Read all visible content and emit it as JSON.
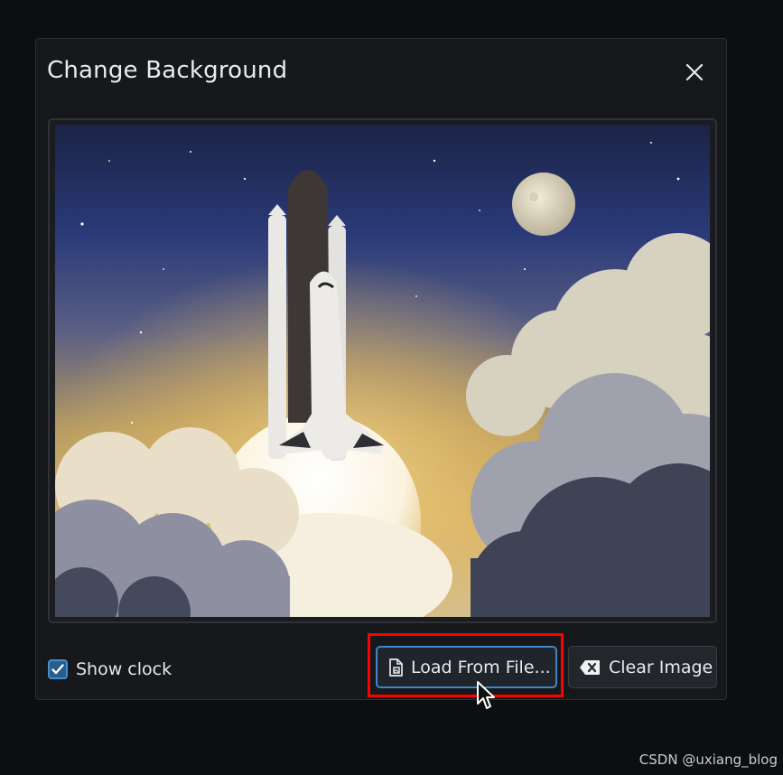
{
  "dialog": {
    "title": "Change Background",
    "close_icon": "close-icon",
    "preview_image": "space-shuttle-launch-illustration"
  },
  "controls": {
    "show_clock_label": "Show clock",
    "show_clock_checked": true,
    "load_button_label": "Load From File...",
    "load_button_icon": "file-image-icon",
    "clear_button_label": "Clear Image",
    "clear_button_icon": "backspace-icon"
  },
  "watermark": "CSDN @uxiang_blog",
  "colors": {
    "accent": "#3f87c6",
    "highlight": "#ff0000",
    "dialog_bg": "#16181b"
  }
}
